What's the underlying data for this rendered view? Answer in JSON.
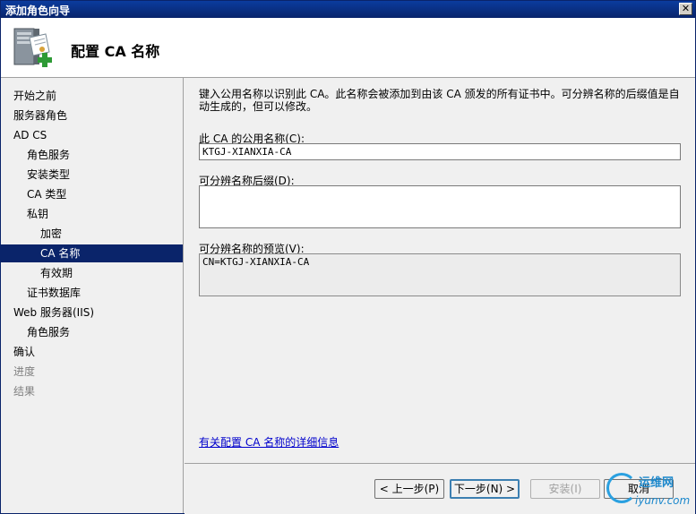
{
  "window": {
    "title": "添加角色向导",
    "close_glyph": "✕"
  },
  "header": {
    "title": "配置 CA 名称",
    "icon": "server-certificate-add-icon"
  },
  "sidebar": {
    "items": [
      {
        "label": "开始之前",
        "level": 0,
        "state": "normal"
      },
      {
        "label": "服务器角色",
        "level": 0,
        "state": "normal"
      },
      {
        "label": "AD CS",
        "level": 0,
        "state": "normal"
      },
      {
        "label": "角色服务",
        "level": 1,
        "state": "normal"
      },
      {
        "label": "安装类型",
        "level": 1,
        "state": "normal"
      },
      {
        "label": "CA 类型",
        "level": 1,
        "state": "normal"
      },
      {
        "label": "私钥",
        "level": 1,
        "state": "normal"
      },
      {
        "label": "加密",
        "level": 2,
        "state": "normal"
      },
      {
        "label": "CA 名称",
        "level": 2,
        "state": "selected"
      },
      {
        "label": "有效期",
        "level": 2,
        "state": "normal"
      },
      {
        "label": "证书数据库",
        "level": 1,
        "state": "normal"
      },
      {
        "label": "Web 服务器(IIS)",
        "level": 0,
        "state": "normal"
      },
      {
        "label": "角色服务",
        "level": 1,
        "state": "normal"
      },
      {
        "label": "确认",
        "level": 0,
        "state": "normal"
      },
      {
        "label": "进度",
        "level": 0,
        "state": "disabled"
      },
      {
        "label": "结果",
        "level": 0,
        "state": "disabled"
      }
    ]
  },
  "main": {
    "intro": "键入公用名称以识别此 CA。此名称会被添加到由该 CA 颁发的所有证书中。可分辨名称的后缀值是自动生成的，但可以修改。",
    "common_name": {
      "label": "此 CA 的公用名称(C):",
      "value": "KTGJ-XIANXIA-CA"
    },
    "dn_suffix": {
      "label": "可分辨名称后缀(D):",
      "value": ""
    },
    "dn_preview": {
      "label": "可分辨名称的预览(V):",
      "value": "CN=KTGJ-XIANXIA-CA"
    },
    "help_link": "有关配置 CA 名称的详细信息"
  },
  "footer": {
    "prev": "< 上一步(P)",
    "next": "下一步(N) >",
    "install": "安装(I)",
    "cancel": "取消"
  },
  "watermark": {
    "line1": "运维网",
    "line2": "iyunv.com"
  }
}
